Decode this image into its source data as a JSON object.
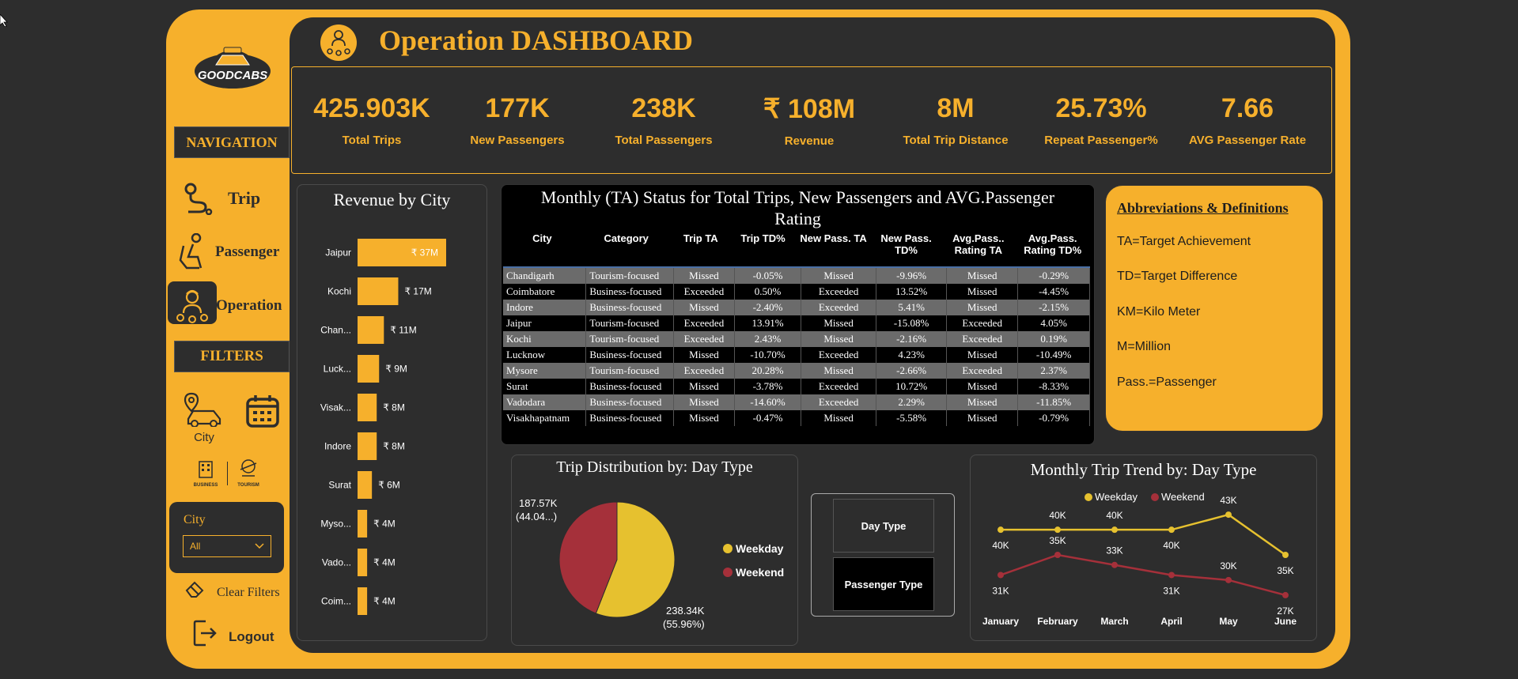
{
  "app": {
    "title": "Operation DASHBOARD",
    "logo_text": "GOODCABS"
  },
  "colors": {
    "accent": "#f6b02c",
    "panel": "#2d2d2d",
    "weekday": "#e6c12f",
    "weekend": "#a5303a"
  },
  "navigation": {
    "label": "NAVIGATION",
    "items": [
      {
        "label": "Trip",
        "icon": "route-icon"
      },
      {
        "label": "Passenger",
        "icon": "seated-passenger-icon"
      },
      {
        "label": "Operation",
        "icon": "operator-icon",
        "active": true
      }
    ]
  },
  "filters": {
    "label": "FILTERS",
    "city_icon_label": "City",
    "category_icons": [
      "BUSINESS",
      "TOURISM"
    ],
    "city_dropdown": {
      "label": "City",
      "value": "All"
    },
    "clear_label": "Clear Filters",
    "logout_label": "Logout"
  },
  "kpis": [
    {
      "value": "425.903K",
      "label": "Total Trips"
    },
    {
      "value": "177K",
      "label": "New Passengers"
    },
    {
      "value": "238K",
      "label": "Total Passengers"
    },
    {
      "value": "₹ 108M",
      "label": "Revenue"
    },
    {
      "value": "8M",
      "label": "Total Trip Distance"
    },
    {
      "value": "25.73%",
      "label": "Repeat Passenger%"
    },
    {
      "value": "7.66",
      "label": "AVG Passenger Rate"
    }
  ],
  "revenue_by_city": {
    "title": "Revenue by City",
    "categories": [
      "Jaipur",
      "Kochi",
      "Chan...",
      "Luck...",
      "Visak...",
      "Indore",
      "Surat",
      "Myso...",
      "Vado...",
      "Coim..."
    ],
    "values": [
      37,
      17,
      11,
      9,
      8,
      8,
      6,
      4,
      4,
      4
    ],
    "labels": [
      "₹ 37M",
      "₹ 17M",
      "₹ 11M",
      "₹ 9M",
      "₹ 8M",
      "₹ 8M",
      "₹ 6M",
      "₹ 4M",
      "₹ 4M",
      "₹ 4M"
    ]
  },
  "status_table": {
    "title_line1": "Monthly (TA) Status for Total Trips, New Passengers and AVG.Passenger",
    "title_line2": "Rating",
    "headers": [
      "City",
      "Category",
      "Trip TA",
      "Trip TD%",
      "New Pass. TA",
      "New Pass. TD%",
      "Avg.Pass.. Rating TA",
      "Avg.Pass. Rating TD%"
    ],
    "rows": [
      [
        "Chandigarh",
        "Tourism-focused",
        "Missed",
        "-0.05%",
        "Missed",
        "-9.96%",
        "Missed",
        "-0.29%"
      ],
      [
        "Coimbatore",
        "Business-focused",
        "Exceeded",
        "0.50%",
        "Exceeded",
        "13.52%",
        "Missed",
        "-4.45%"
      ],
      [
        "Indore",
        "Business-focused",
        "Missed",
        "-2.40%",
        "Exceeded",
        "5.41%",
        "Missed",
        "-2.15%"
      ],
      [
        "Jaipur",
        "Tourism-focused",
        "Exceeded",
        "13.91%",
        "Missed",
        "-15.08%",
        "Exceeded",
        "4.05%"
      ],
      [
        "Kochi",
        "Tourism-focused",
        "Exceeded",
        "2.43%",
        "Missed",
        "-2.16%",
        "Exceeded",
        "0.19%"
      ],
      [
        "Lucknow",
        "Business-focused",
        "Missed",
        "-10.70%",
        "Exceeded",
        "4.23%",
        "Missed",
        "-10.49%"
      ],
      [
        "Mysore",
        "Tourism-focused",
        "Exceeded",
        "20.28%",
        "Missed",
        "-2.66%",
        "Exceeded",
        "2.37%"
      ],
      [
        "Surat",
        "Business-focused",
        "Missed",
        "-3.78%",
        "Exceeded",
        "10.72%",
        "Missed",
        "-8.33%"
      ],
      [
        "Vadodara",
        "Business-focused",
        "Missed",
        "-14.60%",
        "Exceeded",
        "2.29%",
        "Missed",
        "-11.85%"
      ],
      [
        "Visakhapatnam",
        "Business-focused",
        "Missed",
        "-0.47%",
        "Missed",
        "-5.58%",
        "Missed",
        "-0.79%"
      ]
    ]
  },
  "abbreviations": {
    "title": "Abbreviations & Definitions",
    "items": [
      "TA=Target Achievement",
      "TD=Target Difference",
      "KM=Kilo Meter",
      "M=Million",
      "Pass.=Passenger"
    ]
  },
  "chart_data": [
    {
      "type": "bar",
      "title": "Revenue by City",
      "categories": [
        "Jaipur",
        "Kochi",
        "Chan...",
        "Luck...",
        "Visak...",
        "Indore",
        "Surat",
        "Myso...",
        "Vado...",
        "Coim..."
      ],
      "values": [
        37,
        17,
        11,
        9,
        8,
        8,
        6,
        4,
        4,
        4
      ],
      "unit": "₹ M"
    },
    {
      "type": "pie",
      "title": "Trip Distribution by: Day Type",
      "slices": [
        {
          "name": "Weekday",
          "value": 238.34,
          "label_line1": "238.34K",
          "label_line2": "(55.96%)"
        },
        {
          "name": "Weekend",
          "value": 187.57,
          "label_line1": "187.57K",
          "label_line2": "(44.04...)"
        }
      ],
      "legend": [
        "Weekday",
        "Weekend"
      ]
    },
    {
      "type": "line",
      "title": "Monthly Trip Trend by: Day Type",
      "categories": [
        "January",
        "February",
        "March",
        "April",
        "May",
        "June"
      ],
      "series": [
        {
          "name": "Weekday",
          "values": [
            40,
            40,
            40,
            40,
            43,
            35
          ],
          "labels": [
            "40K",
            "40K",
            "40K",
            "40K",
            "43K",
            "35K"
          ]
        },
        {
          "name": "Weekend",
          "values": [
            31,
            35,
            33,
            31,
            30,
            27
          ],
          "labels": [
            "31K",
            "35K",
            "33K",
            "31K",
            "30K",
            "27K"
          ]
        }
      ],
      "legend_position": "top"
    }
  ],
  "segment_buttons": {
    "day_type": "Day Type",
    "passenger_type": "Passenger Type"
  }
}
